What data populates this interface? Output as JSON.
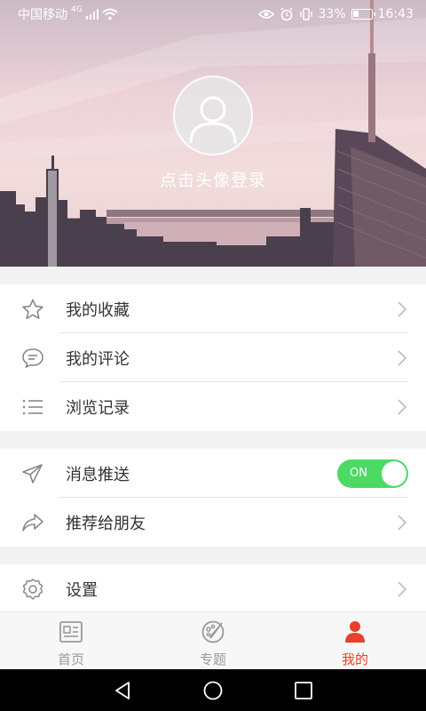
{
  "status_bar": {
    "carrier": "中国移动",
    "network": "4G",
    "battery": "33%",
    "battery_level": 0.33,
    "time": "16:43"
  },
  "profile": {
    "login_prompt": "点击头像登录"
  },
  "menu_group_1": {
    "items": [
      {
        "label": "我的收藏",
        "icon": "star-icon"
      },
      {
        "label": "我的评论",
        "icon": "comment-icon"
      },
      {
        "label": "浏览记录",
        "icon": "list-icon"
      }
    ]
  },
  "menu_group_2": {
    "items": [
      {
        "label": "消息推送",
        "icon": "send-icon",
        "toggle": "ON",
        "enabled": true
      },
      {
        "label": "推荐给朋友",
        "icon": "share-icon"
      }
    ]
  },
  "menu_group_3": {
    "items": [
      {
        "label": "设置",
        "icon": "gear-icon"
      }
    ]
  },
  "tabbar": {
    "tabs": [
      {
        "label": "首页",
        "icon": "news-icon",
        "active": false
      },
      {
        "label": "专题",
        "icon": "palette-icon",
        "active": false
      },
      {
        "label": "我的",
        "icon": "user-icon",
        "active": true
      }
    ]
  },
  "colors": {
    "accent": "#e8402a",
    "toggle_on": "#4cd964"
  }
}
